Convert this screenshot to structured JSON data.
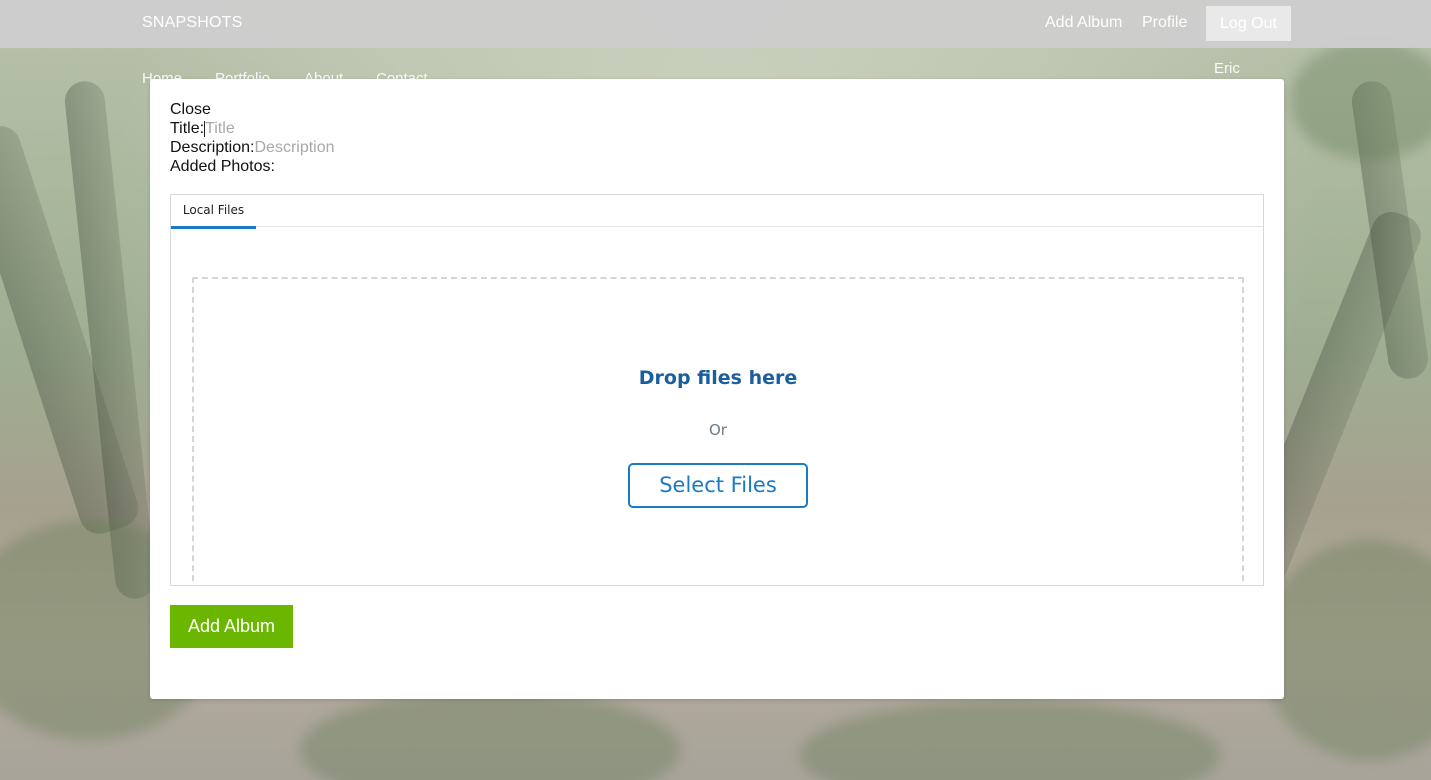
{
  "header": {
    "brand": "SNAPSHOTS",
    "add_album_link": "Add Album",
    "profile_link": "Profile",
    "logout_button": "Log Out",
    "username": "Eric"
  },
  "subnav": {
    "items": [
      "Home",
      "Portfolio",
      "About",
      "Contact"
    ]
  },
  "modal": {
    "close_label": "Close",
    "title_label": "Title:",
    "title_placeholder": "Title",
    "title_value": "",
    "description_label": "Description:",
    "description_placeholder": "Description",
    "description_value": "",
    "added_photos_label": "Added Photos:",
    "picker": {
      "tab_local_files": "Local Files",
      "drop_text": "Drop files here",
      "or_text": "Or",
      "select_button": "Select Files",
      "accent_color": "#1a7bc4"
    },
    "submit_button": "Add Album",
    "submit_color": "#6bb700"
  }
}
